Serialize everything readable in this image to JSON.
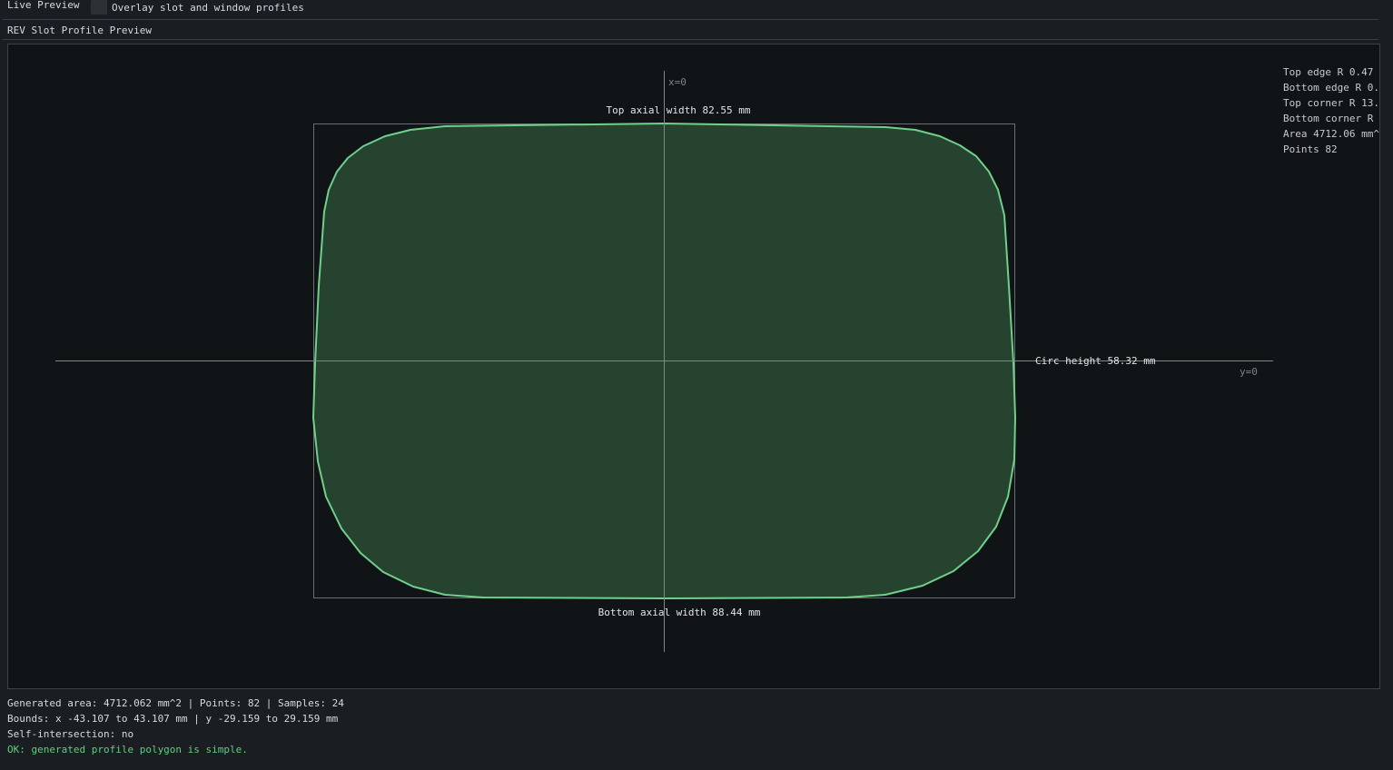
{
  "toolbar": {
    "live_preview_label": "Live Preview",
    "overlay_checkbox_checked": false,
    "overlay_label": "Overlay slot and window profiles"
  },
  "section": {
    "title": "REV Slot Profile Preview"
  },
  "preview": {
    "axis_x_label": "x=0",
    "axis_y_label": "y=0",
    "top_width_label": "Top axial width 82.55 mm",
    "bottom_width_label": "Bottom axial width 88.44 mm",
    "circ_height_label": "Circ height 58.32 mm",
    "colors": {
      "outline": "#6fd08c",
      "fill": "#25432f",
      "background": "#111417",
      "axis": "#7c8a84",
      "bbox": "#6b6f73"
    }
  },
  "stats": {
    "top_edge": "Top edge R 0.47",
    "bottom_edge": "Bottom edge R 0.",
    "top_corner": "Top corner R 13.",
    "bottom_corner": "Bottom corner R",
    "area": "Area 4712.06 mm^",
    "points": "Points 82"
  },
  "footer": {
    "line1": "Generated area: 4712.062 mm^2 | Points: 82 | Samples: 24",
    "line2": "Bounds: x -43.107 to 43.107 mm | y -29.159 to 29.159 mm",
    "line3": "Self-intersection: no",
    "status": "OK: generated profile polygon is simple.",
    "status_color": "#5fcf7f"
  }
}
